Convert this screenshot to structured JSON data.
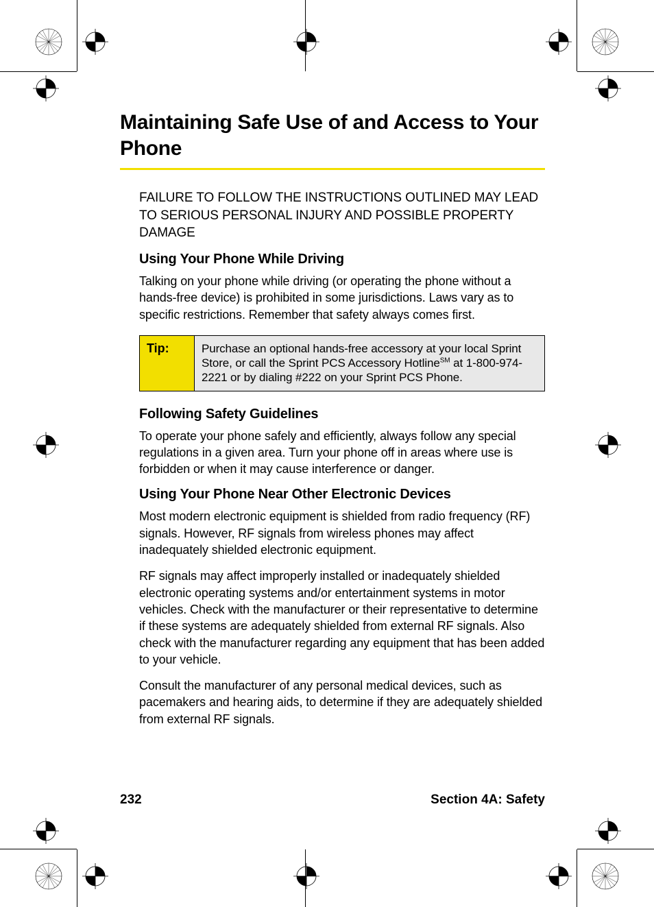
{
  "heading": "Maintaining Safe Use of and Access to Your Phone",
  "warning": "FAILURE TO FOLLOW THE INSTRUCTIONS OUTLINED MAY LEAD TO SERIOUS PERSONAL INJURY AND POSSIBLE PROPERTY DAMAGE",
  "sections": {
    "driving": {
      "title": "Using Your Phone While Driving",
      "body": "Talking on your phone while driving (or operating the phone without a hands-free device) is prohibited in some jurisdictions. Laws vary as to specific restrictions. Remember that safety always comes first."
    },
    "guidelines": {
      "title": "Following Safety Guidelines",
      "body": "To operate your phone safely and efficiently, always follow any special regulations in a given area. Turn your phone off in areas where use is forbidden or when it may cause interference or danger."
    },
    "electronics": {
      "title": "Using Your Phone Near Other Electronic Devices",
      "p1": "Most modern electronic equipment is shielded from radio frequency (RF) signals. However, RF signals from wireless phones may affect inadequately shielded electronic equipment.",
      "p2": "RF signals may affect improperly installed or inadequately shielded electronic operating systems and/or entertainment systems in motor vehicles. Check with the manufacturer or their representative to determine if these systems are adequately shielded from external RF signals. Also check with the manufacturer regarding any equipment that has been added to your vehicle.",
      "p3": "Consult the manufacturer of any personal medical devices, such as pacemakers and hearing aids, to determine if they are adequately shielded from external RF signals."
    }
  },
  "tip": {
    "label": "Tip:",
    "text_before_sm": "Purchase an optional hands-free accessory at your local Sprint Store, or call the Sprint PCS Accessory Hotline",
    "sm": "SM",
    "text_after_sm": " at 1-800-974-2221 or by dialing #222 on your Sprint PCS Phone."
  },
  "footer": {
    "page_number": "232",
    "section_label": "Section 4A: Safety"
  }
}
